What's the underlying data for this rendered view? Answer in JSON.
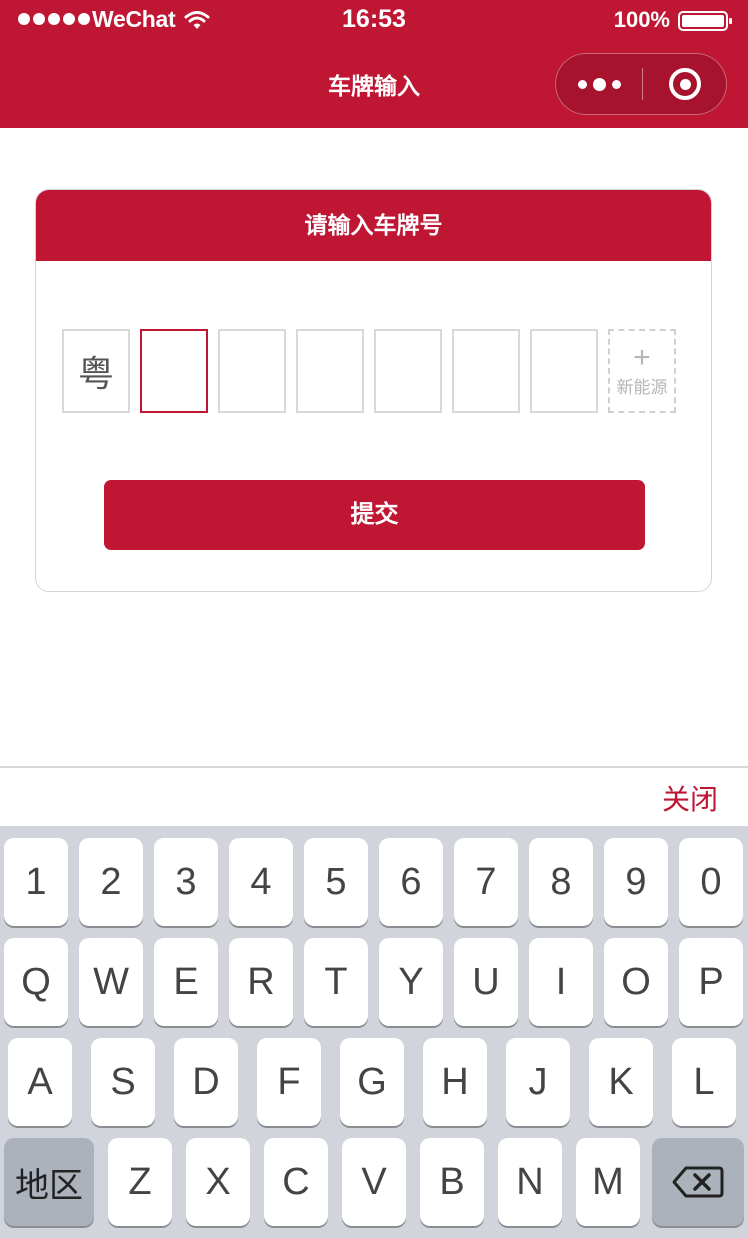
{
  "status_bar": {
    "carrier": "WeChat",
    "time": "16:53",
    "battery": "100%",
    "signal_icon": "signal-dots-icon",
    "wifi_icon": "wifi-icon",
    "battery_icon": "battery-icon"
  },
  "nav": {
    "title": "车牌输入",
    "more_icon": "more-dots-icon",
    "close_icon": "target-close-icon"
  },
  "card": {
    "header": "请输入车牌号",
    "plate": [
      "粤",
      "",
      "",
      "",
      "",
      "",
      ""
    ],
    "new_energy_plus": "+",
    "new_energy_label": "新能源",
    "submit_label": "提交"
  },
  "keyboard": {
    "close_label": "关闭",
    "row1": [
      "1",
      "2",
      "3",
      "4",
      "5",
      "6",
      "7",
      "8",
      "9",
      "0"
    ],
    "row2": [
      "Q",
      "W",
      "E",
      "R",
      "T",
      "Y",
      "U",
      "I",
      "O",
      "P"
    ],
    "row3": [
      "A",
      "S",
      "D",
      "F",
      "G",
      "H",
      "J",
      "K",
      "L"
    ],
    "row4": [
      "Z",
      "X",
      "C",
      "V",
      "B",
      "N",
      "M"
    ],
    "region_label": "地区",
    "backspace_icon": "backspace-icon"
  },
  "colors": {
    "brand": "#bf1634",
    "keyboard_bg": "#d1d5db",
    "key_bg": "#ffffff"
  }
}
